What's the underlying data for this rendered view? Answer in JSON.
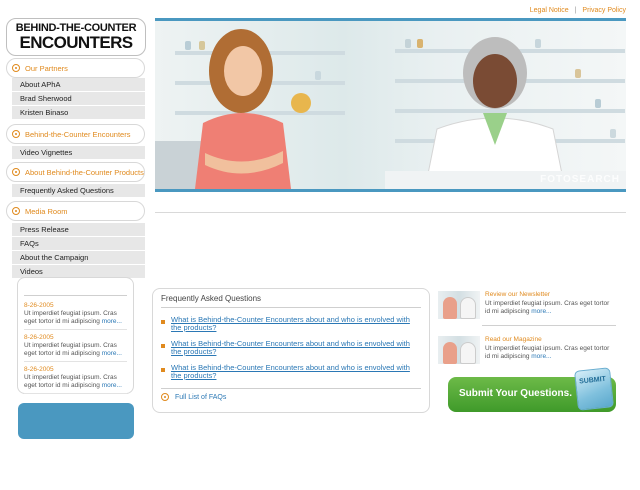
{
  "top_links": {
    "legal": "Legal Notice",
    "sep": "|",
    "privacy": "Privacy Policy"
  },
  "logo": {
    "line1": "BEHIND-THE-COUNTER",
    "line2": "ENCOUNTERS"
  },
  "nav": {
    "partners": "Our Partners",
    "partners_items": [
      "About APhA",
      "Brad Sherwood",
      "Kristen Binaso"
    ],
    "btc": "Behind-the-Counter Encounters",
    "btc_items": [
      "Video Vignettes"
    ],
    "products": "About Behind-the-Counter Products",
    "products_items": [
      "Frequently Asked Questions"
    ],
    "media": "Media Room",
    "media_items": [
      "Press Release",
      "FAQs",
      "About the Campaign",
      "Videos"
    ]
  },
  "hero": {
    "watermark": "FOTOSEARCH"
  },
  "news": [
    {
      "date": "8-26-2005",
      "text": "Ut imperdiet feugiat ipsum. Cras eget tortor id mi adipiscing ",
      "more": "more..."
    },
    {
      "date": "8-26-2005",
      "text": "Ut imperdiet feugiat ipsum. Cras eget tortor id mi adipiscing ",
      "more": "more..."
    },
    {
      "date": "8-26-2005",
      "text": "Ut imperdiet feugiat ipsum. Cras eget tortor id mi adipiscing ",
      "more": "more..."
    }
  ],
  "faq": {
    "title": "Frequently Asked Questions",
    "questions": [
      "What is Behind-the-Counter Encounters about and who is envolved with the products?",
      "What is Behind-the-Counter Encounters about and who is envolved with the products?",
      "What is Behind-the-Counter Encounters about and who is envolved with the products?"
    ],
    "full_list": "Full List of FAQs"
  },
  "promos": {
    "newsletter": {
      "title": "Review our Newsletter",
      "text": "Ut imperdiet feugiat ipsum. Cras eget tortor id mi adipiscing ",
      "more": "more..."
    },
    "magazine": {
      "title": "Read our Magazine",
      "text": "Ut imperdiet feugiat ipsum. Cras eget tortor id mi adipiscing ",
      "more": "more..."
    }
  },
  "submit": {
    "label": "Submit Your Questions.",
    "key": "SUBMIT"
  },
  "colors": {
    "accent_orange": "#e08a1e",
    "link_blue": "#2b78b5",
    "frame_blue": "#4a98c0",
    "submit_green": "#4fa631"
  }
}
